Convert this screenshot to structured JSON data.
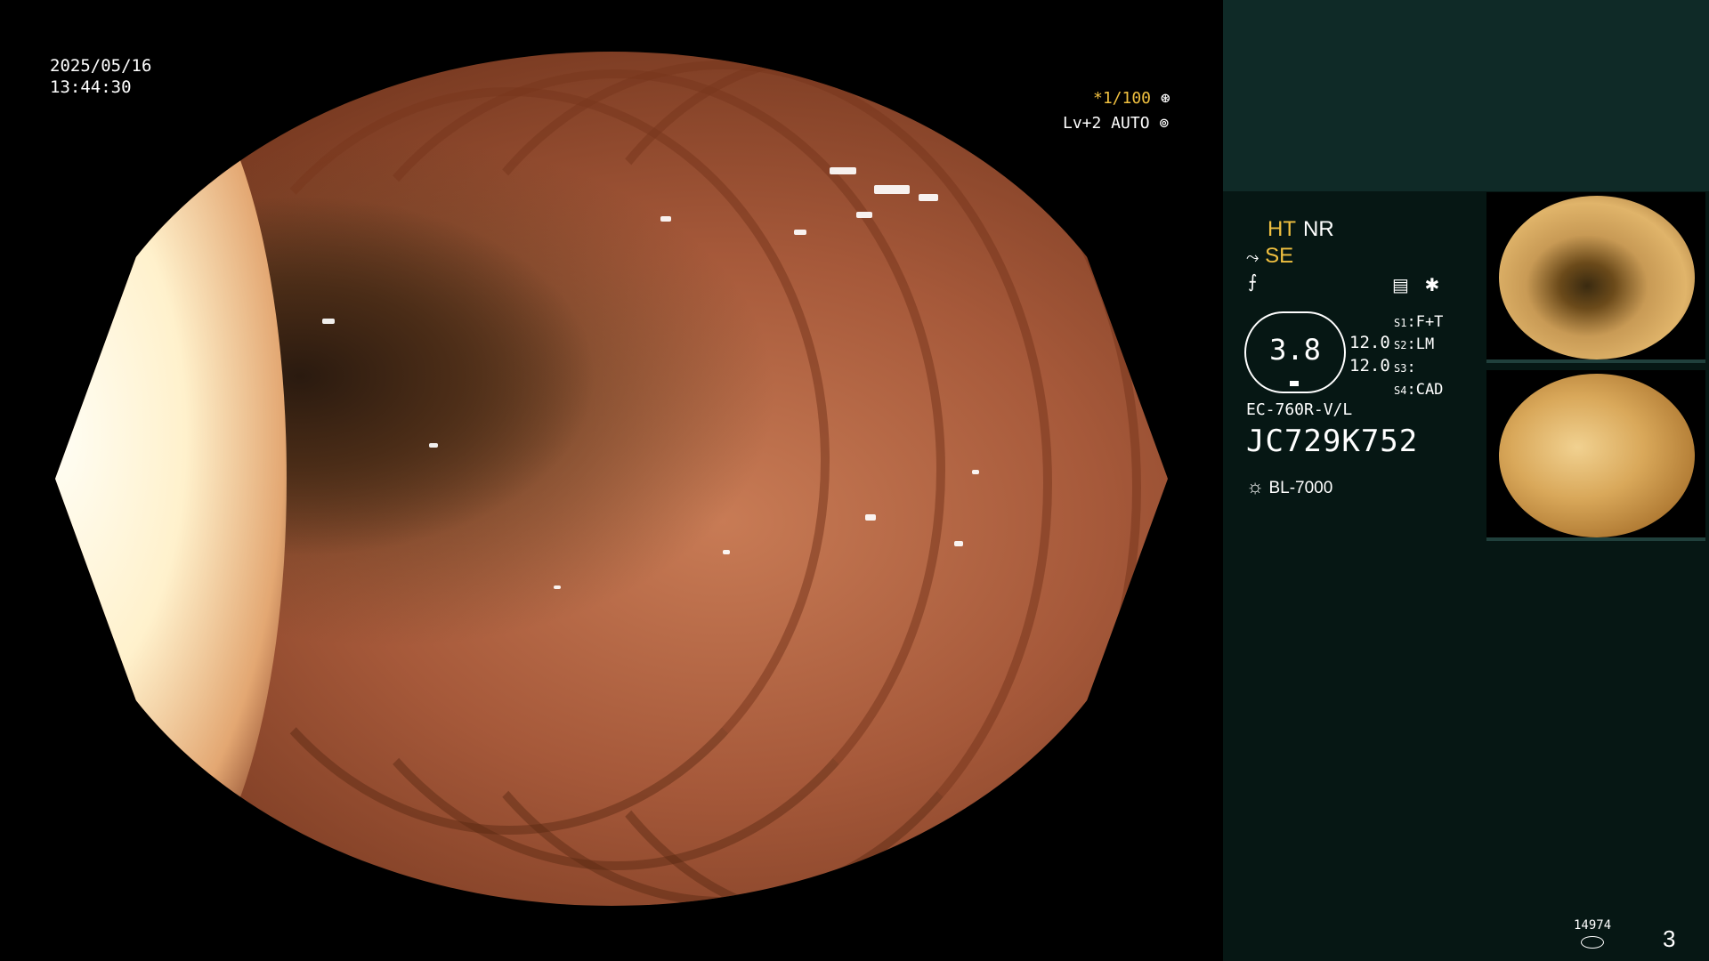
{
  "overlay": {
    "date": "2025/05/16",
    "time": "13:44:30",
    "shutter": "*1/100",
    "level_mode": "Lv+2 AUTO"
  },
  "panel": {
    "ht": "HT",
    "nr": "NR",
    "se": "SE",
    "gauge_value": "3.8",
    "gauge_right_top": "12.0",
    "gauge_right_bottom": "12.0",
    "s_settings": [
      {
        "key": "S1",
        "value": "F+T"
      },
      {
        "key": "S2",
        "value": "LM"
      },
      {
        "key": "S3",
        "value": ""
      },
      {
        "key": "S4",
        "value": "CAD"
      }
    ],
    "scope_model": "EC-760R-V/L",
    "scope_serial": "JC729K752",
    "light_source": "BL-7000"
  },
  "footer": {
    "counter": "14974",
    "page_number": "3"
  },
  "colors": {
    "accent_yellow": "#f0c040",
    "panel_bg": "#061714",
    "panel_top": "#0f2a27"
  }
}
